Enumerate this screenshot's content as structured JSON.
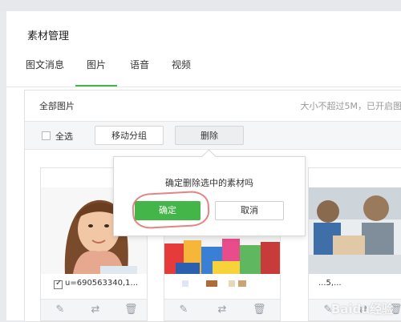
{
  "page": {
    "title": "素材管理"
  },
  "tabs": [
    {
      "label": "图文消息",
      "active": false
    },
    {
      "label": "图片",
      "active": true
    },
    {
      "label": "语音",
      "active": false
    },
    {
      "label": "视频",
      "active": false
    }
  ],
  "panel": {
    "title": "全部图片",
    "hint": "大小不超过5M，已开启图"
  },
  "toolbar": {
    "select_all_label": "全选",
    "move_label": "移动分组",
    "delete_label": "删除"
  },
  "items": [
    {
      "filename": "u=690563340,1...",
      "checked": true
    },
    {
      "filename": "",
      "checked": false
    },
    {
      "filename": "...5,...",
      "checked": false
    }
  ],
  "item_actions": [
    "edit-icon",
    "move-icon",
    "trash-icon"
  ],
  "popover": {
    "message": "确定删除选中的素材吗",
    "confirm_label": "确定",
    "cancel_label": "取消"
  },
  "watermark": "Baidu经验",
  "colors": {
    "accent": "#44b549",
    "annotation": "#e26d6d"
  }
}
